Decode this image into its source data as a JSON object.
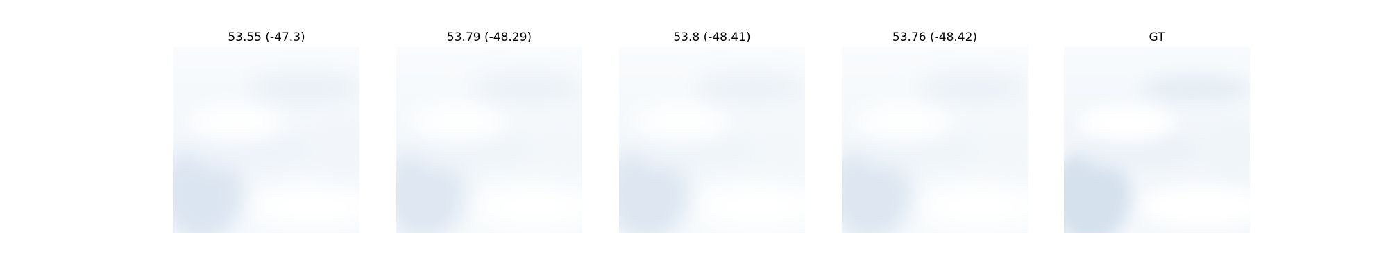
{
  "figure": {
    "panels": [
      {
        "title": "53.55 (-47.3)",
        "image": "cloudy-sky-reconstruction-1"
      },
      {
        "title": "53.79 (-48.29)",
        "image": "cloudy-sky-reconstruction-2"
      },
      {
        "title": "53.8 (-48.41)",
        "image": "cloudy-sky-reconstruction-3"
      },
      {
        "title": "53.76 (-48.42)",
        "image": "cloudy-sky-reconstruction-4"
      },
      {
        "title": "GT",
        "image": "cloudy-sky-ground-truth"
      }
    ],
    "colors": {
      "sky_light": "#f7fafc",
      "sky_mid": "#eef3f8",
      "sky_blue": "#dde7f2",
      "cloud_white": "#fdfefe"
    }
  }
}
